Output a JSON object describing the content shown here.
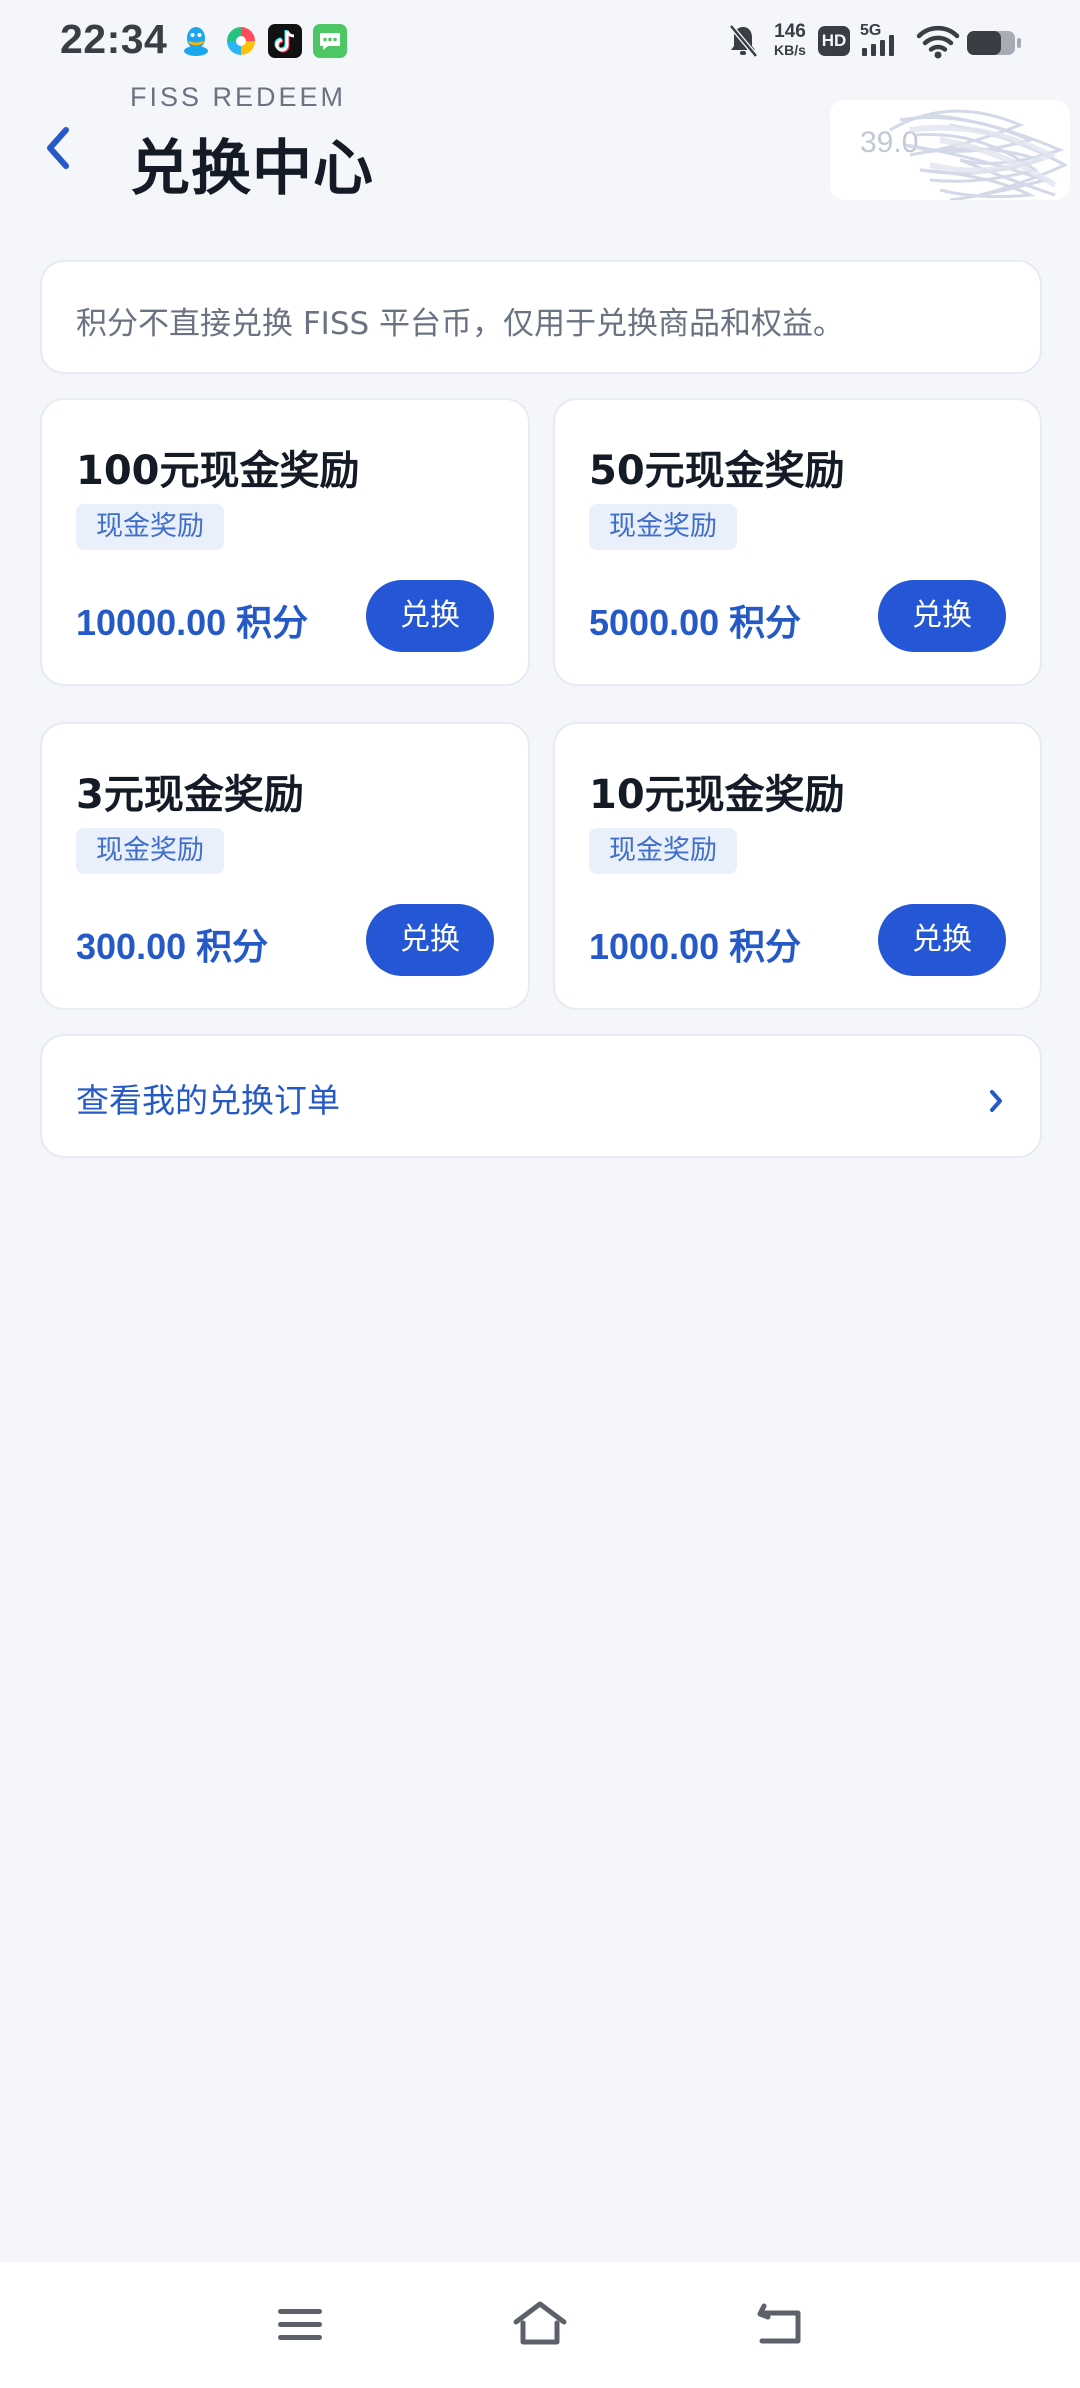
{
  "status_bar": {
    "time": "22:34",
    "net_speed_value": "146",
    "net_speed_unit": "KB/s",
    "hd_label": "HD",
    "network_label": "5G",
    "icons": [
      "qq-icon",
      "pinwheel-app-icon",
      "tiktok-icon",
      "messages-icon",
      "mute-bell-icon",
      "hd-icon",
      "signal-icon",
      "wifi-icon",
      "battery-icon"
    ]
  },
  "header": {
    "subtitle": "FISS REDEEM",
    "title": "兑换中心",
    "balance_visible": "39.0"
  },
  "notice": {
    "text": "积分不直接兑换 FISS 平台币，仅用于兑换商品和权益。"
  },
  "rewards": [
    {
      "title": "100元现金奖励",
      "tag": "现金奖励",
      "points": "10000.00",
      "points_unit": "积分",
      "button": "兑换"
    },
    {
      "title": "50元现金奖励",
      "tag": "现金奖励",
      "points": "5000.00",
      "points_unit": "积分",
      "button": "兑换"
    },
    {
      "title": "3元现金奖励",
      "tag": "现金奖励",
      "points": "300.00",
      "points_unit": "积分",
      "button": "兑换"
    },
    {
      "title": "10元现金奖励",
      "tag": "现金奖励",
      "points": "1000.00",
      "points_unit": "积分",
      "button": "兑换"
    }
  ],
  "orders_link": {
    "label": "查看我的兑换订单"
  },
  "colors": {
    "accent": "#2456d6",
    "accent_text": "#2559c8",
    "background": "#f4f6fa",
    "card": "#ffffff",
    "tag_bg": "#e9f0fc"
  }
}
